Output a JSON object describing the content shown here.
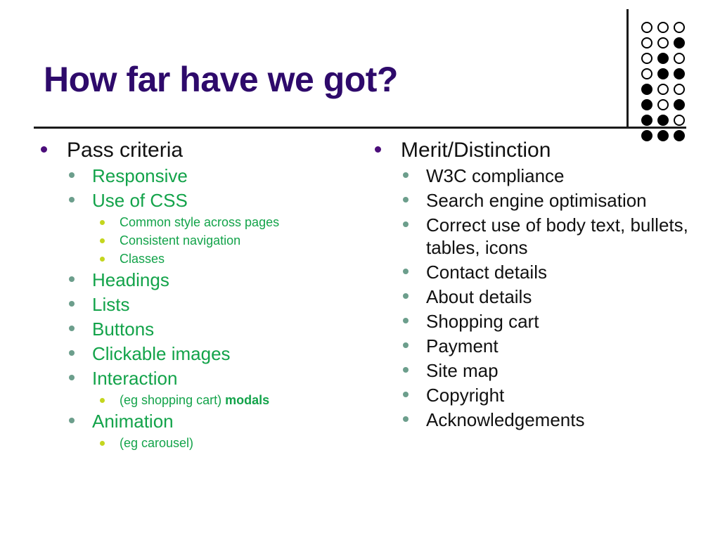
{
  "slide": {
    "title": "How far have we got?",
    "title_color": "#2e0a6b",
    "background_color": "#ffffff",
    "rule_color": "#1a1a1a"
  },
  "logo": {
    "name": "binary-dot-matrix-logo",
    "columns": 3,
    "rows": 8,
    "filled_color": "#000000",
    "empty_color": "#ffffff",
    "pattern": [
      [
        0,
        0,
        0
      ],
      [
        0,
        0,
        1
      ],
      [
        0,
        1,
        0
      ],
      [
        0,
        1,
        1
      ],
      [
        1,
        0,
        0
      ],
      [
        1,
        0,
        1
      ],
      [
        1,
        1,
        0
      ],
      [
        1,
        1,
        1
      ]
    ]
  },
  "bullet_colors": {
    "level1": "#4b0d7a",
    "level2": "#6c9e8c",
    "level3": "#c4d61e"
  },
  "text_colors": {
    "level1": "#111111",
    "left_sub": "#13a34a",
    "right_sub": "#111111"
  },
  "columns": {
    "left": {
      "name": "pass-criteria-column",
      "items": [
        {
          "level": 1,
          "text": "Pass criteria"
        },
        {
          "level": 2,
          "text": "Responsive"
        },
        {
          "level": 2,
          "text": "Use of CSS"
        },
        {
          "level": 3,
          "text": "Common style across pages"
        },
        {
          "level": 3,
          "text": "Consistent navigation"
        },
        {
          "level": 3,
          "text": "Classes"
        },
        {
          "level": 2,
          "text": "Headings"
        },
        {
          "level": 2,
          "text": "Lists"
        },
        {
          "level": 2,
          "text": "Buttons"
        },
        {
          "level": 2,
          "text": "Clickable images"
        },
        {
          "level": 2,
          "text": "Interaction"
        },
        {
          "level": 3,
          "text": "(eg shopping cart) modals",
          "bold_tail": "modals",
          "plain_head": "(eg shopping cart) "
        },
        {
          "level": 2,
          "text": "Animation"
        },
        {
          "level": 3,
          "text": "(eg carousel)"
        }
      ]
    },
    "right": {
      "name": "merit-distinction-column",
      "items": [
        {
          "level": 1,
          "text": "Merit/Distinction"
        },
        {
          "level": 2,
          "text": "W3C compliance"
        },
        {
          "level": 2,
          "text": "Search engine optimisation"
        },
        {
          "level": 2,
          "text": "Correct use of body text, bullets, tables, icons"
        },
        {
          "level": 2,
          "text": "Contact details"
        },
        {
          "level": 2,
          "text": "About details"
        },
        {
          "level": 2,
          "text": "Shopping cart"
        },
        {
          "level": 2,
          "text": "Payment"
        },
        {
          "level": 2,
          "text": "Site map"
        },
        {
          "level": 2,
          "text": "Copyright"
        },
        {
          "level": 2,
          "text": "Acknowledgements"
        }
      ]
    }
  }
}
